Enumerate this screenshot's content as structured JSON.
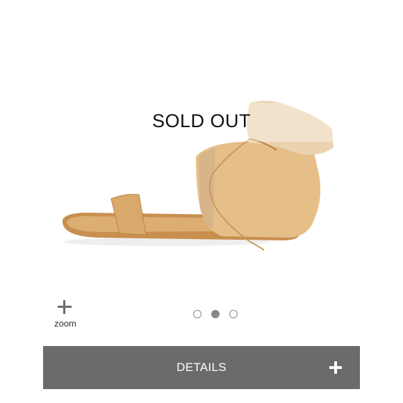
{
  "product": {
    "image_name": "tan suede ankle-wrap flat sandal",
    "sold_out_label": "SOLD OUT"
  },
  "gallery": {
    "zoom_label": "zoom",
    "slide_count": 3,
    "active_slide": 2
  },
  "details": {
    "label": "DETAILS"
  },
  "colors": {
    "details_bar": "#6b6b6b",
    "sandal_leather": "#d9a96b",
    "sandal_suede": "#e8c28e"
  }
}
